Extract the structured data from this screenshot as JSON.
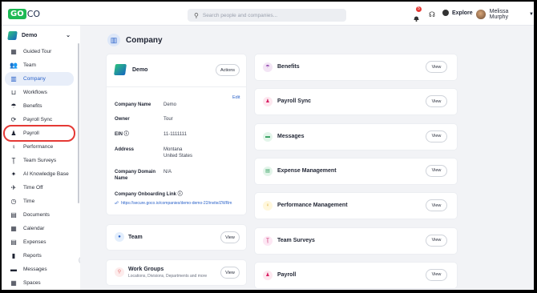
{
  "header": {
    "logo_go": "GO",
    "logo_co": "CO",
    "search_placeholder": "Search people and companies...",
    "notification_count": "5",
    "explore_label": "Explore",
    "user_name": "Melissa Murphy"
  },
  "sidebar": {
    "org_name": "Demo",
    "items": [
      {
        "label": "Guided Tour",
        "icon": "map-icon",
        "glyph": "▦"
      },
      {
        "label": "Team",
        "icon": "team-icon",
        "glyph": "👥"
      },
      {
        "label": "Company",
        "icon": "building-icon",
        "glyph": "▥"
      },
      {
        "label": "Workflows",
        "icon": "workflow-icon",
        "glyph": "⊔"
      },
      {
        "label": "Benefits",
        "icon": "umbrella-icon",
        "glyph": "☂"
      },
      {
        "label": "Payroll Sync",
        "icon": "sync-icon",
        "glyph": "⟳"
      },
      {
        "label": "Payroll",
        "icon": "payroll-icon",
        "glyph": "♟"
      },
      {
        "label": "Performance",
        "icon": "performance-icon",
        "glyph": "♀"
      },
      {
        "label": "Team Surveys",
        "icon": "survey-icon",
        "glyph": "Ţ"
      },
      {
        "label": "AI Knowledge Base",
        "icon": "sparkle-icon",
        "glyph": "✦"
      },
      {
        "label": "Time Off",
        "icon": "plane-icon",
        "glyph": "✈"
      },
      {
        "label": "Time",
        "icon": "clock-icon",
        "glyph": "◷"
      },
      {
        "label": "Documents",
        "icon": "document-icon",
        "glyph": "▤"
      },
      {
        "label": "Calendar",
        "icon": "calendar-icon",
        "glyph": "▦"
      },
      {
        "label": "Expenses",
        "icon": "expenses-icon",
        "glyph": "▤"
      },
      {
        "label": "Reports",
        "icon": "reports-icon",
        "glyph": "▮"
      },
      {
        "label": "Messages",
        "icon": "message-icon",
        "glyph": "▬"
      },
      {
        "label": "Spaces",
        "icon": "spaces-icon",
        "glyph": "▦"
      }
    ]
  },
  "page": {
    "title": "Company"
  },
  "company_card": {
    "name": "Demo",
    "actions_label": "Actions",
    "edit_label": "Edit",
    "fields": [
      {
        "key": "Company Name",
        "value": "Demo"
      },
      {
        "key": "Owner",
        "value": "Tour"
      },
      {
        "key": "EIN ⓘ",
        "value": "11-1111111"
      },
      {
        "key": "Address",
        "value": "Montana\nUnited States"
      },
      {
        "key": "Company Domain Name",
        "value": "N/A"
      }
    ],
    "onboarding_label": "Company Onboarding Link ⓘ",
    "onboarding_link": "https://secure.goco.io/companies/demo-demo-22/invite/ZWRm"
  },
  "team_card": {
    "label": "Team",
    "view_label": "View"
  },
  "work_groups_card": {
    "label": "Work Groups",
    "sub": "Locations, Divisions, Departments and more",
    "view_label": "View"
  },
  "right_cards": [
    {
      "label": "Benefits",
      "view_label": "View",
      "icon": "umbrella-icon",
      "color": "#f3e5f5",
      "fg": "#8e44ad",
      "glyph": "☂"
    },
    {
      "label": "Payroll Sync",
      "view_label": "View",
      "icon": "payroll-sync-icon",
      "color": "#fde7ef",
      "fg": "#d81b60",
      "glyph": "♟"
    },
    {
      "label": "Messages",
      "view_label": "View",
      "icon": "message-icon",
      "color": "#e3f5ea",
      "fg": "#2e9d5b",
      "glyph": "▬"
    },
    {
      "label": "Expense Management",
      "view_label": "View",
      "icon": "expense-icon",
      "color": "#e3f5ea",
      "fg": "#2e9d5b",
      "glyph": "▤"
    },
    {
      "label": "Performance Management",
      "view_label": "View",
      "icon": "performance-icon",
      "color": "#fff7dc",
      "fg": "#d4a017",
      "glyph": "♀"
    },
    {
      "label": "Team Surveys",
      "view_label": "View",
      "icon": "survey-icon",
      "color": "#fde7f4",
      "fg": "#c2185b",
      "glyph": "Ţ"
    },
    {
      "label": "Payroll",
      "view_label": "View",
      "icon": "payroll-icon",
      "color": "#fde7ef",
      "fg": "#d81b60",
      "glyph": "♟"
    }
  ]
}
